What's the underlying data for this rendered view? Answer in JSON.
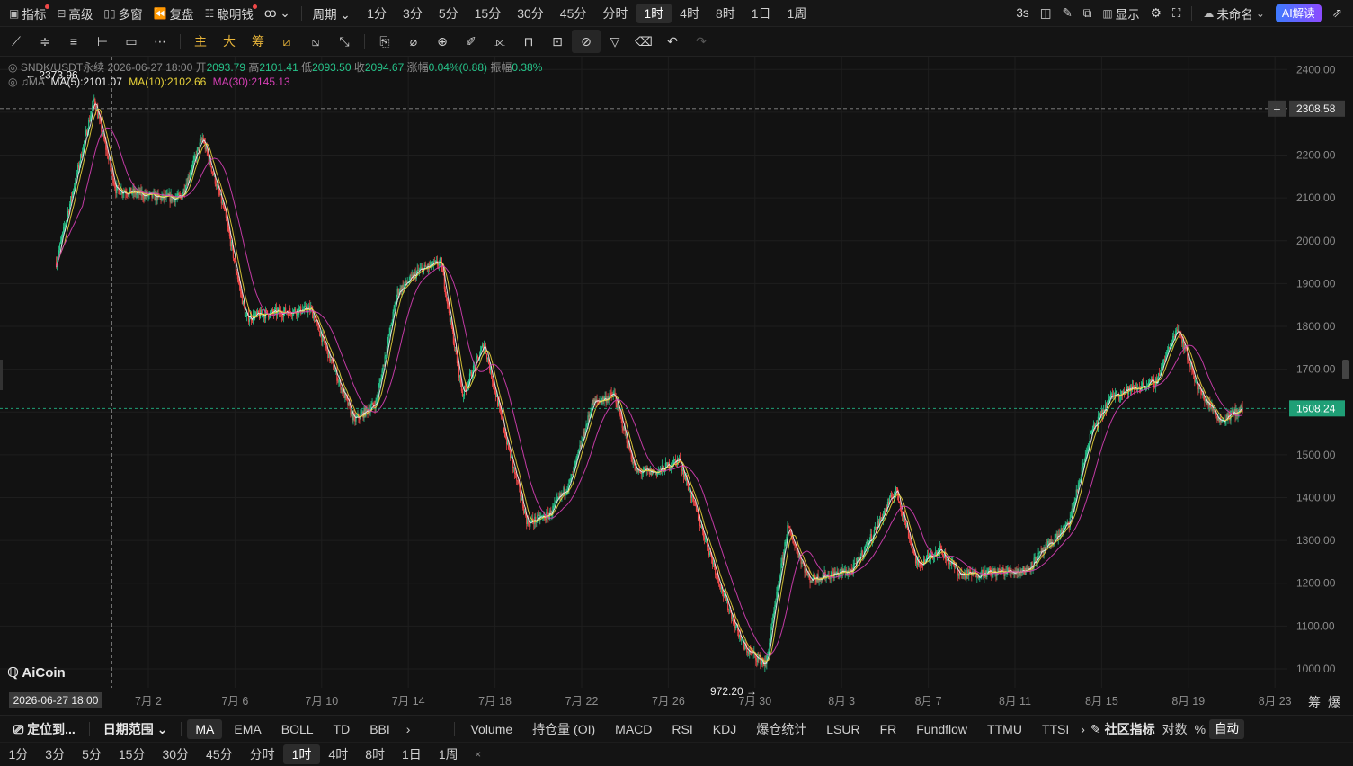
{
  "topbar": {
    "left": [
      {
        "label": "指标",
        "icon": "indicator-icon",
        "dot": true
      },
      {
        "label": "高级",
        "icon": "advanced-icon"
      },
      {
        "label": "多窗",
        "icon": "multi-window-icon"
      },
      {
        "label": "复盘",
        "icon": "replay-icon"
      },
      {
        "label": "聪明钱",
        "icon": "smart-money-icon",
        "dot": true
      }
    ],
    "more_label": "ꝏ ⌄",
    "period_label": "周期 ⌄",
    "periods": [
      "1分",
      "3分",
      "5分",
      "15分",
      "30分",
      "45分",
      "分时",
      "1时",
      "4时",
      "8时",
      "1日",
      "1周"
    ],
    "active_period": "1时",
    "refresh_label": "3s",
    "display_label": "显示",
    "layout_name": "未命名",
    "ai_label": "AI解读"
  },
  "legend": {
    "symbol": "SNDK/USDT永续",
    "time": "2026-06-27 18:00",
    "open_label": "开",
    "open": "2093.79",
    "high_label": "高",
    "high": "2101.41",
    "low_label": "低",
    "low": "2093.50",
    "close_label": "收",
    "close": "2094.67",
    "change_label": "涨幅",
    "change": "0.04%(0.88)",
    "amp_label": "振幅",
    "amp": "0.38%",
    "ma_tag": "MA",
    "ma5": "MA(5):2101.07",
    "ma10": "MA(10):2102.66",
    "ma30": "MA(30):2145.13"
  },
  "colors": {
    "up": "#26c48a",
    "down": "#f04848",
    "ma5": "#f0f0f0",
    "ma10": "#e8d23a",
    "ma30": "#d63fb5",
    "accent": "#1f9f76"
  },
  "chart_data": {
    "type": "candlestick",
    "ylim": [
      960,
      2430
    ],
    "y_ticks": [
      1000,
      1100,
      1200,
      1300,
      1400,
      1500,
      1600,
      1700,
      1800,
      1900,
      2000,
      2100,
      2200,
      2300,
      2400
    ],
    "y_tick_labels": [
      "1000.00",
      "1100.00",
      "1200.00",
      "1300.00",
      "1400.00",
      "1500.00",
      "1600.00",
      "1700.00",
      "1800.00",
      "1900.00",
      "2000.00",
      "2100.00",
      "2200.00",
      "2300.00",
      "2400.00"
    ],
    "x_start": "2026-06-27 18:00",
    "x_labels": [
      "7月 2",
      "7月 6",
      "7月 10",
      "7月 14",
      "7月 18",
      "7月 22",
      "7月 26",
      "7月 30",
      "8月 3",
      "8月 7",
      "8月 11",
      "8月 15",
      "8月 19",
      "8月 23"
    ],
    "cursor_time_label": "2026-06-27 18:00",
    "cursor_price_label": "2308.58",
    "cursor_price": 2308.58,
    "last_price_label": "1608.24",
    "last_price": 1608.24,
    "max_label": "← 2373.96",
    "max_price": 2373.96,
    "min_label": "972.20 →",
    "min_price": 972.2,
    "path_anchors": [
      {
        "date": "2026-06-27",
        "price": 1950
      },
      {
        "date": "2026-06-29",
        "price": 2330
      },
      {
        "date": "2026-06-30",
        "price": 2120
      },
      {
        "date": "2026-07-02",
        "price": 2100
      },
      {
        "date": "2026-07-03",
        "price": 2100
      },
      {
        "date": "2026-07-04",
        "price": 2240
      },
      {
        "date": "2026-07-05",
        "price": 2070
      },
      {
        "date": "2026-07-06",
        "price": 1820
      },
      {
        "date": "2026-07-07",
        "price": 1830
      },
      {
        "date": "2026-07-09",
        "price": 1840
      },
      {
        "date": "2026-07-11",
        "price": 1580
      },
      {
        "date": "2026-07-12",
        "price": 1620
      },
      {
        "date": "2026-07-13",
        "price": 1880
      },
      {
        "date": "2026-07-14",
        "price": 1930
      },
      {
        "date": "2026-07-15",
        "price": 1950
      },
      {
        "date": "2026-07-16",
        "price": 1640
      },
      {
        "date": "2026-07-17",
        "price": 1760
      },
      {
        "date": "2026-07-18",
        "price": 1540
      },
      {
        "date": "2026-07-19",
        "price": 1340
      },
      {
        "date": "2026-07-20",
        "price": 1360
      },
      {
        "date": "2026-07-21",
        "price": 1440
      },
      {
        "date": "2026-07-22",
        "price": 1620
      },
      {
        "date": "2026-07-23",
        "price": 1640
      },
      {
        "date": "2026-07-24",
        "price": 1460
      },
      {
        "date": "2026-07-25",
        "price": 1460
      },
      {
        "date": "2026-07-26",
        "price": 1490
      },
      {
        "date": "2026-07-28",
        "price": 1180
      },
      {
        "date": "2026-07-29",
        "price": 1050
      },
      {
        "date": "2026-07-30",
        "price": 1010
      },
      {
        "date": "2026-07-31",
        "price": 1330
      },
      {
        "date": "2026-08-01",
        "price": 1210
      },
      {
        "date": "2026-08-03",
        "price": 1230
      },
      {
        "date": "2026-08-04",
        "price": 1320
      },
      {
        "date": "2026-08-05",
        "price": 1420
      },
      {
        "date": "2026-08-06",
        "price": 1240
      },
      {
        "date": "2026-08-07",
        "price": 1280
      },
      {
        "date": "2026-08-08",
        "price": 1220
      },
      {
        "date": "2026-08-11",
        "price": 1230
      },
      {
        "date": "2026-08-13",
        "price": 1340
      },
      {
        "date": "2026-08-14",
        "price": 1550
      },
      {
        "date": "2026-08-15",
        "price": 1640
      },
      {
        "date": "2026-08-17",
        "price": 1670
      },
      {
        "date": "2026-08-18",
        "price": 1800
      },
      {
        "date": "2026-08-19",
        "price": 1650
      },
      {
        "date": "2026-08-20",
        "price": 1580
      },
      {
        "date": "2026-08-21",
        "price": 1608
      }
    ],
    "series": [
      "K线",
      "MA(5)",
      "MA(10)",
      "MA(30)"
    ]
  },
  "logo_text": "AiCoin",
  "bottom": {
    "locate_label": "定位到...",
    "date_range_label": "日期范围 ⌄",
    "main_indicators": [
      "MA",
      "EMA",
      "BOLL",
      "TD",
      "BBI"
    ],
    "active_main": "MA",
    "sub_indicators": [
      "Volume",
      "持仓量 (OI)",
      "MACD",
      "RSI",
      "KDJ",
      "爆仓统计",
      "LSUR",
      "FR",
      "Fundflow",
      "TTMU",
      "TTSI"
    ],
    "community_label": "社区指标",
    "log_label": "对数",
    "pct_label": "%",
    "auto_label": "自动",
    "right_tags": [
      "筹",
      "爆"
    ],
    "quick_periods": [
      "1分",
      "3分",
      "5分",
      "15分",
      "30分",
      "45分",
      "分时",
      "1时",
      "4时",
      "8时",
      "1日",
      "1周"
    ],
    "quick_active": "1时",
    "close_label": "×"
  }
}
